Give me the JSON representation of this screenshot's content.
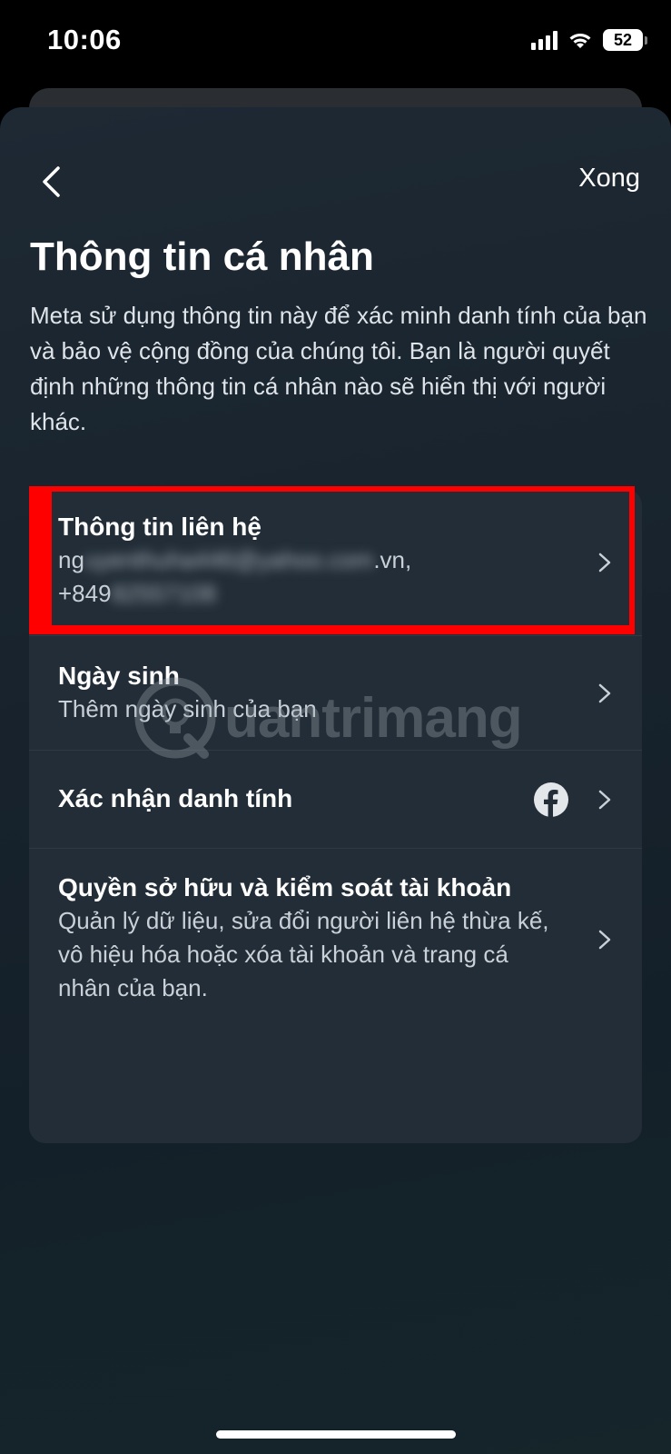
{
  "status_bar": {
    "time": "10:06",
    "battery": "52"
  },
  "nav": {
    "done_label": "Xong"
  },
  "page": {
    "title": "Thông tin cá nhân",
    "description": "Meta sử dụng thông tin này để xác minh danh tính của bạn và bảo vệ cộng đồng của chúng tôi. Bạn là người quyết định những thông tin cá nhân nào sẽ hiển thị với người khác."
  },
  "rows": [
    {
      "title": "Thông tin liên hệ",
      "subtitle_line1_prefix": "ng",
      "subtitle_line1_blurred": "uyenthuha446@yahoo.com",
      "subtitle_line1_suffix": ".vn,",
      "subtitle_line2_prefix": "+849",
      "subtitle_line2_blurred": "82557108"
    },
    {
      "title": "Ngày sinh",
      "subtitle": "Thêm ngày sinh của bạn"
    },
    {
      "title": "Xác nhận danh tính",
      "icon": "facebook-icon"
    },
    {
      "title": "Quyền sở hữu và kiểm soát tài khoản",
      "subtitle": "Quản lý dữ liệu, sửa đổi người liên hệ thừa kế, vô hiệu hóa hoặc xóa tài khoản và trang cá nhân của bạn."
    }
  ],
  "watermark": "uantrimang",
  "colors": {
    "highlight": "#ff0000",
    "sheet_bg": "#17222c",
    "card_bg": "#222d37"
  }
}
